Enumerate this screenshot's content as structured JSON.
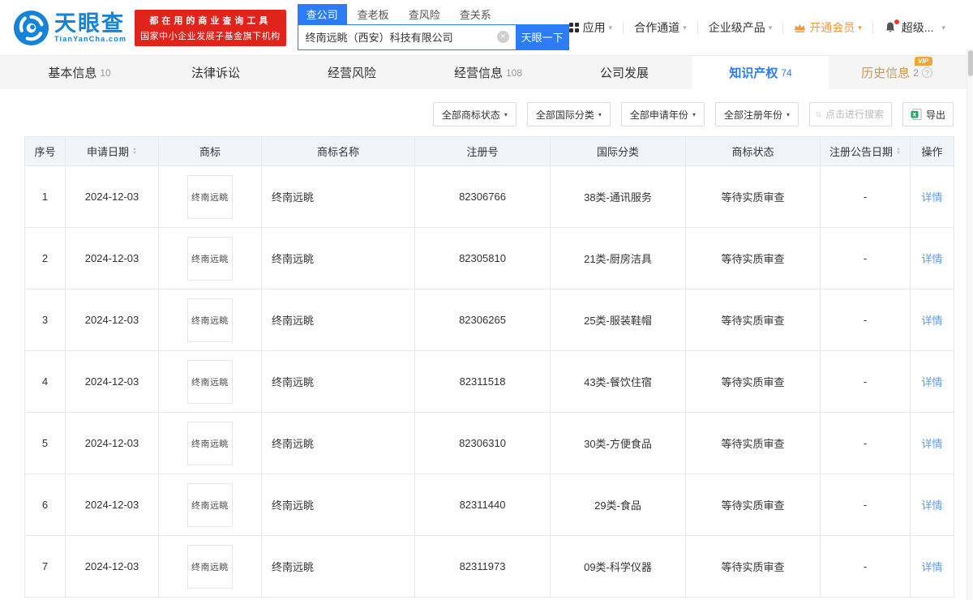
{
  "header": {
    "logo": {
      "brand": "天眼查",
      "domain": "TianYanCha.com"
    },
    "promo": {
      "line1": "都在用的商业查询工具",
      "line2": "国家中小企业发展子基金旗下机构"
    },
    "search": {
      "tabs": [
        {
          "label": "查公司",
          "active": true
        },
        {
          "label": "查老板",
          "active": false
        },
        {
          "label": "查风险",
          "active": false
        },
        {
          "label": "查关系",
          "active": false
        }
      ],
      "value": "终南远眺（西安）科技有限公司",
      "button": "天眼一下"
    },
    "menu": [
      {
        "label": "应用"
      },
      {
        "label": "合作通道"
      },
      {
        "label": "企业级产品"
      },
      {
        "label": "开通会员"
      },
      {
        "label": "超级..."
      }
    ]
  },
  "nav": {
    "vip_badge": "VIP",
    "tabs": [
      {
        "label": "基本信息",
        "count": "10"
      },
      {
        "label": "法律诉讼",
        "count": ""
      },
      {
        "label": "经营风险",
        "count": ""
      },
      {
        "label": "经营信息",
        "count": "108"
      },
      {
        "label": "公司发展",
        "count": ""
      },
      {
        "label": "知识产权",
        "count": "74",
        "active": true
      },
      {
        "label": "历史信息",
        "count": "2",
        "vip": true
      }
    ]
  },
  "filters": {
    "dropdowns": [
      "全部商标状态",
      "全部国际分类",
      "全部申请年份",
      "全部注册年份"
    ],
    "search_placeholder": "点击进行搜索",
    "export_label": "导出"
  },
  "table": {
    "columns": [
      "序号",
      "申请日期",
      "商标",
      "商标名称",
      "注册号",
      "国际分类",
      "商标状态",
      "注册公告日期",
      "操作"
    ],
    "rows": [
      {
        "no": "1",
        "date": "2024-12-03",
        "mark": "终南远眺",
        "name": "终南远眺",
        "reg_no": "82306766",
        "intl_class": "38类-通讯服务",
        "status": "等待实质审查",
        "pub_date": "-",
        "action": "详情"
      },
      {
        "no": "2",
        "date": "2024-12-03",
        "mark": "终南远眺",
        "name": "终南远眺",
        "reg_no": "82305810",
        "intl_class": "21类-厨房洁具",
        "status": "等待实质审查",
        "pub_date": "-",
        "action": "详情"
      },
      {
        "no": "3",
        "date": "2024-12-03",
        "mark": "终南远眺",
        "name": "终南远眺",
        "reg_no": "82306265",
        "intl_class": "25类-服装鞋帽",
        "status": "等待实质审查",
        "pub_date": "-",
        "action": "详情"
      },
      {
        "no": "4",
        "date": "2024-12-03",
        "mark": "终南远眺",
        "name": "终南远眺",
        "reg_no": "82311518",
        "intl_class": "43类-餐饮住宿",
        "status": "等待实质审查",
        "pub_date": "-",
        "action": "详情"
      },
      {
        "no": "5",
        "date": "2024-12-03",
        "mark": "终南远眺",
        "name": "终南远眺",
        "reg_no": "82306310",
        "intl_class": "30类-方便食品",
        "status": "等待实质审查",
        "pub_date": "-",
        "action": "详情"
      },
      {
        "no": "6",
        "date": "2024-12-03",
        "mark": "终南远眺",
        "name": "终南远眺",
        "reg_no": "82311440",
        "intl_class": "29类-食品",
        "status": "等待实质审查",
        "pub_date": "-",
        "action": "详情"
      },
      {
        "no": "7",
        "date": "2024-12-03",
        "mark": "终南远眺",
        "name": "终南远眺",
        "reg_no": "82311973",
        "intl_class": "09类-科学仪器",
        "status": "等待实质审查",
        "pub_date": "-",
        "action": "详情"
      }
    ]
  },
  "icons": {
    "caret_down": "▾",
    "sort_up": "▲",
    "sort_down": "▼",
    "clear": "×",
    "help": "?"
  },
  "colors": {
    "brand_blue": "#2b7cf6",
    "logo_blue": "#1583d6",
    "brand_red": "#e0241c",
    "vip_orange": "#f2a33c",
    "member_orange": "#ef9a3c",
    "history_gold": "#d09a52",
    "link_blue": "#5b9cf8",
    "export_green": "#21a366",
    "table_header_bg": "#f1f5fa"
  }
}
